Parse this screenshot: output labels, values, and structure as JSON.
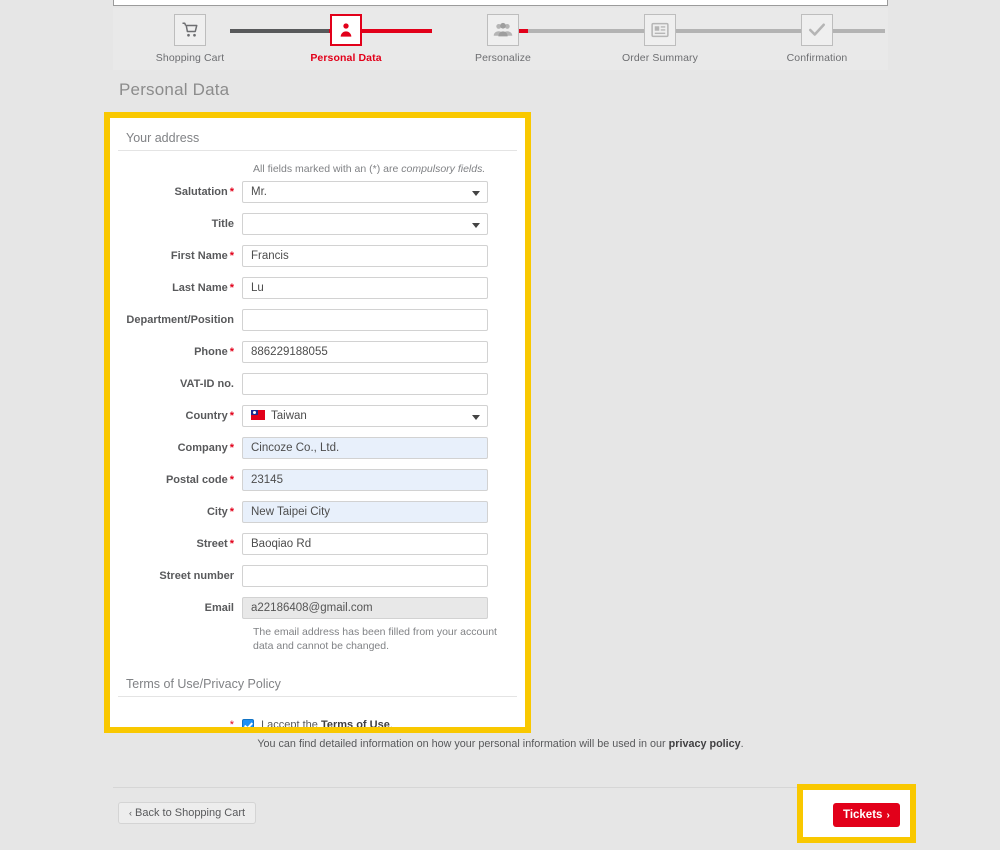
{
  "steps": [
    {
      "label": "Shopping Cart",
      "icon": "shopping-cart-icon",
      "state": "done"
    },
    {
      "label": "Personal Data",
      "icon": "person-icon",
      "state": "active"
    },
    {
      "label": "Personalize",
      "icon": "people-group-icon",
      "state": "pending"
    },
    {
      "label": "Order Summary",
      "icon": "document-list-icon",
      "state": "pending"
    },
    {
      "label": "Confirmation",
      "icon": "check-icon",
      "state": "pending"
    }
  ],
  "page": {
    "title": "Personal Data"
  },
  "form": {
    "section_title": "Your address",
    "compulsory_hint_prefix": "All fields marked with an (*) are ",
    "compulsory_hint_italic": "compulsory fields.",
    "fields": [
      {
        "label": "Salutation",
        "required": true,
        "type": "select",
        "value": "Mr."
      },
      {
        "label": "Title",
        "required": false,
        "type": "select",
        "value": ""
      },
      {
        "label": "First Name",
        "required": true,
        "type": "text",
        "value": "Francis"
      },
      {
        "label": "Last Name",
        "required": true,
        "type": "text",
        "value": "Lu"
      },
      {
        "label": "Department/Position",
        "required": false,
        "type": "text",
        "value": ""
      },
      {
        "label": "Phone",
        "required": true,
        "type": "text",
        "value": "886229188055"
      },
      {
        "label": "VAT-ID no.",
        "required": false,
        "type": "text",
        "value": ""
      },
      {
        "label": "Country",
        "required": true,
        "type": "select-flag",
        "value": "Taiwan"
      },
      {
        "label": "Company",
        "required": true,
        "type": "text",
        "value": "Cincoze Co., Ltd.",
        "style": "filled-blue"
      },
      {
        "label": "Postal code",
        "required": true,
        "type": "text",
        "value": "23145",
        "style": "filled-blue"
      },
      {
        "label": "City",
        "required": true,
        "type": "text",
        "value": "New Taipei City",
        "style": "filled-blue"
      },
      {
        "label": "Street",
        "required": true,
        "type": "text",
        "value": "Baoqiao Rd"
      },
      {
        "label": "Street number",
        "required": false,
        "type": "text",
        "value": ""
      },
      {
        "label": "Email",
        "required": false,
        "type": "text",
        "value": "a22186408@gmail.com",
        "style": "disabled-gray"
      }
    ],
    "email_note": "The email address has been filled from your account data and cannot be changed."
  },
  "terms": {
    "section_title": "Terms of Use/Privacy Policy",
    "required_marker": "*",
    "accept_prefix": "I accept the ",
    "accept_link": "Terms of Use",
    "accept_suffix": ".",
    "checked": true
  },
  "privacy": {
    "prefix": "You can find detailed information on how your personal information will be used in our ",
    "link": "privacy policy",
    "suffix": "."
  },
  "footer": {
    "back_label": "Back to Shopping Cart",
    "back_chevron": "‹",
    "next_label": "Tickets",
    "next_chevron": "›"
  },
  "colors": {
    "brand_red": "#e2001a",
    "highlight_yellow": "#f9c800",
    "page_bg": "#e6e6e6",
    "prefilled_blue": "#e8f0fb",
    "disabled_gray": "#e8e8e8"
  }
}
